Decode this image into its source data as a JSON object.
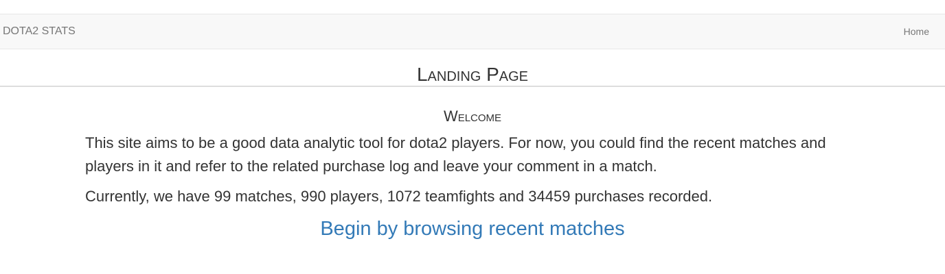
{
  "navbar": {
    "brand": "DOTA2 STATS",
    "home_label": "Home"
  },
  "page": {
    "title": "Landing Page",
    "welcome_heading": "Welcome",
    "intro_text": "This site aims to be a good data analytic tool for dota2 players. For now, you could find the recent matches and players in it and refer to the related purchase log and leave your comment in a match.",
    "stats_text": "Currently, we have 99 matches, 990 players, 1072 teamfights and 34459 purchases recorded.",
    "cta_link": "Begin by browsing recent matches"
  },
  "colors": {
    "navbar_bg": "#f8f8f8",
    "link": "#337ab7",
    "text": "#333333",
    "nav_text": "#777777"
  }
}
